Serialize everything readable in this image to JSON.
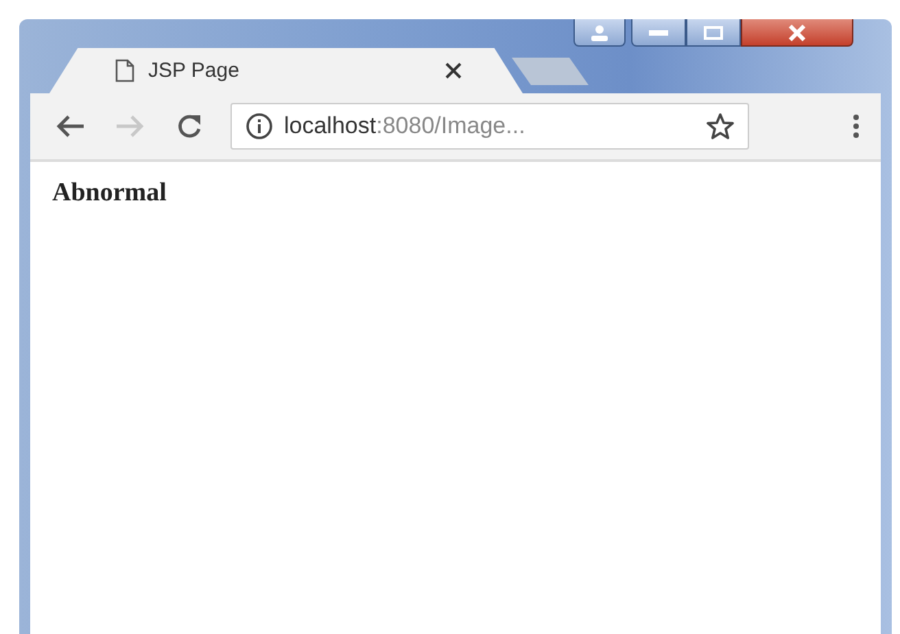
{
  "tab": {
    "title": "JSP Page",
    "selected": true
  },
  "toolbar": {
    "back": {
      "disabled": false
    },
    "forward": {
      "disabled": true
    }
  },
  "address_bar": {
    "host": "localhost",
    "path": ":8080/Image..."
  },
  "page": {
    "text": "Abnormal"
  }
}
